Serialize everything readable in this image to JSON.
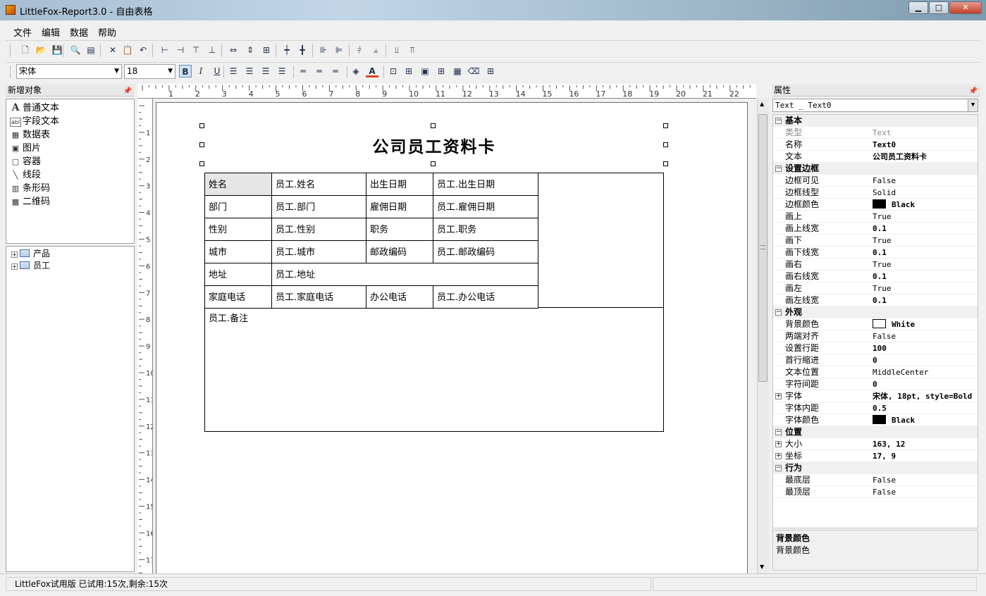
{
  "window": {
    "title": "LittleFox-Report3.0 - 自由表格",
    "minimize": "▁",
    "maximize": "□",
    "close": "✕"
  },
  "menu": [
    {
      "label": "文件"
    },
    {
      "label": "编辑"
    },
    {
      "label": "数据"
    },
    {
      "label": "帮助"
    }
  ],
  "toolbar1": [
    {
      "icon": "new-file-icon",
      "glyph": "🗋"
    },
    {
      "icon": "open-folder-icon",
      "glyph": "📂"
    },
    {
      "icon": "save-icon",
      "glyph": "💾"
    },
    {
      "icon": "print-preview-icon",
      "glyph": "🔍"
    },
    {
      "icon": "page-setup-icon",
      "glyph": "▤"
    },
    {
      "icon": "cut-icon",
      "glyph": "✕"
    },
    {
      "icon": "paste-icon",
      "glyph": "📋"
    },
    {
      "icon": "undo-icon",
      "glyph": "↶"
    },
    {
      "icon": "align-left-icon",
      "glyph": "⊢"
    },
    {
      "icon": "align-right-icon",
      "glyph": "⊣"
    },
    {
      "icon": "align-top-icon",
      "glyph": "⊤"
    },
    {
      "icon": "align-bottom-icon",
      "glyph": "⊥"
    },
    {
      "icon": "same-width-icon",
      "glyph": "⇔"
    },
    {
      "icon": "same-height-icon",
      "glyph": "⇕"
    },
    {
      "icon": "same-size-icon",
      "glyph": "⊞"
    },
    {
      "icon": "center-vertical-icon",
      "glyph": "┿"
    },
    {
      "icon": "center-horizontal-icon",
      "glyph": "╋"
    },
    {
      "icon": "hspace-equal-icon",
      "glyph": "⊪"
    },
    {
      "icon": "hspace-decrease-icon",
      "glyph": "⊫"
    },
    {
      "icon": "vspace-equal-icon",
      "glyph": "⫩"
    },
    {
      "icon": "vspace-decrease-icon",
      "glyph": "⫨"
    },
    {
      "icon": "bring-front-icon",
      "glyph": "⫫"
    },
    {
      "icon": "send-back-icon",
      "glyph": "⫪"
    }
  ],
  "format": {
    "font_name": "宋体",
    "font_size": "18",
    "bold": "B",
    "italic": "I",
    "underline": "U",
    "buttons": [
      {
        "icon": "text-align-left-icon",
        "glyph": "☰"
      },
      {
        "icon": "text-align-center-icon",
        "glyph": "☰"
      },
      {
        "icon": "text-align-right-icon",
        "glyph": "☰"
      },
      {
        "icon": "text-justify-icon",
        "glyph": "☰"
      },
      {
        "icon": "valign-top-icon",
        "glyph": "═"
      },
      {
        "icon": "valign-middle-icon",
        "glyph": "═"
      },
      {
        "icon": "valign-bottom-icon",
        "glyph": "═"
      },
      {
        "icon": "fill-color-icon",
        "glyph": "◈"
      },
      {
        "icon": "font-color-icon",
        "glyph": "A"
      },
      {
        "icon": "border-none-icon",
        "glyph": "⊡"
      },
      {
        "icon": "border-all-icon",
        "glyph": "⊞"
      },
      {
        "icon": "border-outer-icon",
        "glyph": "▣"
      },
      {
        "icon": "border-inner-icon",
        "glyph": "⊞"
      },
      {
        "icon": "border-top-icon",
        "glyph": "▦"
      },
      {
        "icon": "clear-format-icon",
        "glyph": "⌫"
      },
      {
        "icon": "grid-icon",
        "glyph": "⊞"
      }
    ]
  },
  "new_objects": {
    "title": "新增对象",
    "items": [
      {
        "label": "普通文本",
        "icon": "text-icon",
        "glyph": "A"
      },
      {
        "label": "字段文本",
        "icon": "field-text-icon",
        "glyph": "abl"
      },
      {
        "label": "数据表",
        "icon": "datatable-icon",
        "glyph": "▦"
      },
      {
        "label": "图片",
        "icon": "picture-icon",
        "glyph": "▣"
      },
      {
        "label": "容器",
        "icon": "container-icon",
        "glyph": "▢"
      },
      {
        "label": "线段",
        "icon": "line-icon",
        "glyph": "╲"
      },
      {
        "label": "条形码",
        "icon": "barcode-icon",
        "glyph": "▥"
      },
      {
        "label": "二维码",
        "icon": "qrcode-icon",
        "glyph": "▩"
      }
    ]
  },
  "datasource_tree": [
    {
      "label": "产品"
    },
    {
      "label": "员工"
    }
  ],
  "ruler": {
    "h": [
      "1",
      "2",
      "3",
      "4",
      "5",
      "6",
      "7",
      "8",
      "9",
      "10",
      "11",
      "12",
      "13",
      "14",
      "15",
      "16",
      "17",
      "18",
      "19",
      "20",
      "21",
      "22"
    ],
    "v": [
      "1",
      "2",
      "3",
      "4",
      "5",
      "6",
      "7",
      "8",
      "9",
      "10",
      "11",
      "12",
      "13",
      "14",
      "15",
      "16",
      "17"
    ]
  },
  "report": {
    "title": "公司员工资料卡",
    "rows": [
      [
        "姓名",
        "员工.姓名",
        "出生日期",
        "员工.出生日期"
      ],
      [
        "部门",
        "员工.部门",
        "雇佣日期",
        "员工.雇佣日期"
      ],
      [
        "性别",
        "员工.性别",
        "职务",
        "员工.职务"
      ],
      [
        "城市",
        "员工.城市",
        "邮政编码",
        "员工.邮政编码"
      ],
      [
        "地址",
        "员工.地址"
      ],
      [
        "家庭电话",
        "员工.家庭电话",
        "办公电话",
        "员工.办公电话"
      ]
    ],
    "notes": "员工.备注"
  },
  "properties": {
    "title": "属性",
    "selector": "Text _ Text0",
    "categories": [
      {
        "name": "基本",
        "rows": [
          {
            "name": "类型",
            "value": "Text",
            "dim": true
          },
          {
            "name": "名称",
            "value": "Text0",
            "bold": true
          },
          {
            "name": "文本",
            "value": "公司员工资料卡",
            "bold": true
          }
        ]
      },
      {
        "name": "设置边框",
        "rows": [
          {
            "name": "边框可见",
            "value": "False"
          },
          {
            "name": "边框线型",
            "value": "Solid"
          },
          {
            "name": "边框颜色",
            "value": "Black",
            "bold": true,
            "swatch": "#000000"
          },
          {
            "name": "画上",
            "value": "True"
          },
          {
            "name": "画上线宽",
            "value": "0.1",
            "bold": true
          },
          {
            "name": "画下",
            "value": "True"
          },
          {
            "name": "画下线宽",
            "value": "0.1",
            "bold": true
          },
          {
            "name": "画右",
            "value": "True"
          },
          {
            "name": "画右线宽",
            "value": "0.1",
            "bold": true
          },
          {
            "name": "画左",
            "value": "True"
          },
          {
            "name": "画左线宽",
            "value": "0.1",
            "bold": true
          }
        ]
      },
      {
        "name": "外观",
        "rows": [
          {
            "name": "背景颜色",
            "value": "White",
            "bold": true,
            "swatch": "#ffffff"
          },
          {
            "name": "两端对齐",
            "value": "False"
          },
          {
            "name": "设置行距",
            "value": "100",
            "bold": true
          },
          {
            "name": "首行缩进",
            "value": "0",
            "bold": true
          },
          {
            "name": "文本位置",
            "value": "MiddleCenter"
          },
          {
            "name": "字符间距",
            "value": "0",
            "bold": true
          },
          {
            "name": "字体",
            "value": "宋体, 18pt, style=Bold",
            "bold": true,
            "expand": true
          },
          {
            "name": "字体内距",
            "value": "0.5",
            "bold": true
          },
          {
            "name": "字体颜色",
            "value": "Black",
            "bold": true,
            "swatch": "#000000"
          }
        ]
      },
      {
        "name": "位置",
        "rows": [
          {
            "name": "大小",
            "value": "163, 12",
            "bold": true,
            "expand": true
          },
          {
            "name": "坐标",
            "value": "17, 9",
            "bold": true,
            "expand": true
          }
        ]
      },
      {
        "name": "行为",
        "rows": [
          {
            "name": "最底层",
            "value": "False"
          },
          {
            "name": "最顶层",
            "value": "False"
          }
        ]
      }
    ],
    "help_title": "背景颜色",
    "help_text": "背景颜色"
  },
  "status": {
    "text": "LittleFox试用版 已试用:15次,剩余:15次"
  }
}
